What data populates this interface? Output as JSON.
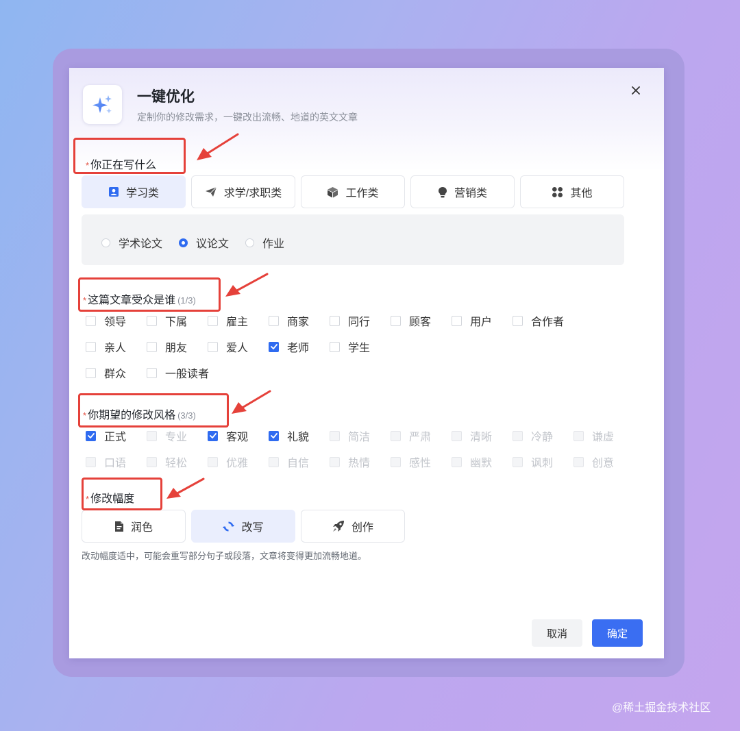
{
  "dialog": {
    "title": "一键优化",
    "subtitle": "定制你的修改需求，一键改出流畅、地道的英文文章",
    "close_icon": "close-icon",
    "logo_icon": "sparkle-icon"
  },
  "writing_type": {
    "required_mark": "*",
    "label": "你正在写什么",
    "categories": [
      {
        "label": "学习类",
        "icon": "user-card-icon",
        "selected": true
      },
      {
        "label": "求学/求职类",
        "icon": "paper-plane-icon",
        "selected": false
      },
      {
        "label": "工作类",
        "icon": "cube-icon",
        "selected": false
      },
      {
        "label": "营销类",
        "icon": "lightbulb-icon",
        "selected": false
      },
      {
        "label": "其他",
        "icon": "grid-icon",
        "selected": false
      }
    ],
    "subtypes": [
      {
        "label": "学术论文",
        "selected": false
      },
      {
        "label": "议论文",
        "selected": true
      },
      {
        "label": "作业",
        "selected": false
      }
    ]
  },
  "audience": {
    "required_mark": "*",
    "label": "这篇文章受众是谁",
    "count": "(1/3)",
    "options": [
      {
        "label": "领导",
        "checked": false
      },
      {
        "label": "下属",
        "checked": false
      },
      {
        "label": "雇主",
        "checked": false
      },
      {
        "label": "商家",
        "checked": false
      },
      {
        "label": "同行",
        "checked": false
      },
      {
        "label": "顾客",
        "checked": false
      },
      {
        "label": "用户",
        "checked": false
      },
      {
        "label": "合作者",
        "checked": false
      },
      {
        "label": "亲人",
        "checked": false
      },
      {
        "label": "朋友",
        "checked": false
      },
      {
        "label": "爱人",
        "checked": false
      },
      {
        "label": "老师",
        "checked": true
      },
      {
        "label": "学生",
        "checked": false
      },
      {
        "label": "群众",
        "checked": false
      },
      {
        "label": "一般读者",
        "checked": false
      }
    ]
  },
  "style": {
    "required_mark": "*",
    "label": "你期望的修改风格",
    "count": "(3/3)",
    "options": [
      {
        "label": "正式",
        "checked": true,
        "disabled": false
      },
      {
        "label": "专业",
        "checked": false,
        "disabled": true
      },
      {
        "label": "客观",
        "checked": true,
        "disabled": false
      },
      {
        "label": "礼貌",
        "checked": true,
        "disabled": false
      },
      {
        "label": "简洁",
        "checked": false,
        "disabled": true
      },
      {
        "label": "严肃",
        "checked": false,
        "disabled": true
      },
      {
        "label": "清晰",
        "checked": false,
        "disabled": true
      },
      {
        "label": "冷静",
        "checked": false,
        "disabled": true
      },
      {
        "label": "谦虚",
        "checked": false,
        "disabled": true
      },
      {
        "label": "口语",
        "checked": false,
        "disabled": true
      },
      {
        "label": "轻松",
        "checked": false,
        "disabled": true
      },
      {
        "label": "优雅",
        "checked": false,
        "disabled": true
      },
      {
        "label": "自信",
        "checked": false,
        "disabled": true
      },
      {
        "label": "热情",
        "checked": false,
        "disabled": true
      },
      {
        "label": "感性",
        "checked": false,
        "disabled": true
      },
      {
        "label": "幽默",
        "checked": false,
        "disabled": true
      },
      {
        "label": "讽刺",
        "checked": false,
        "disabled": true
      },
      {
        "label": "创意",
        "checked": false,
        "disabled": true
      }
    ]
  },
  "level": {
    "required_mark": "*",
    "label": "修改幅度",
    "options": [
      {
        "label": "润色",
        "icon": "document-icon",
        "selected": false
      },
      {
        "label": "改写",
        "icon": "refresh-icon",
        "selected": true
      },
      {
        "label": "创作",
        "icon": "rocket-icon",
        "selected": false
      }
    ],
    "hint": "改动幅度适中，可能会重写部分句子或段落，文章将变得更加流畅地道。"
  },
  "footer": {
    "cancel_label": "取消",
    "confirm_label": "确定"
  },
  "watermark": "@稀土掘金技术社区",
  "colors": {
    "accent": "#3a6ef2",
    "annotation": "#e5413a",
    "selected_bg": "#eaeefd"
  }
}
